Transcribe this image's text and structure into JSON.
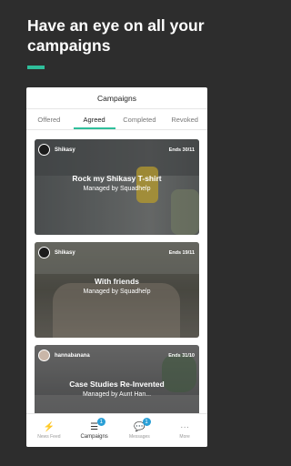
{
  "headline": "Have an eye on all your campaigns",
  "colors": {
    "accent": "#2fbf9b",
    "background": "#2d2d2d",
    "badge": "#2a9fd6"
  },
  "app": {
    "title": "Campaigns"
  },
  "tabs": [
    {
      "label": "Offered"
    },
    {
      "label": "Agreed"
    },
    {
      "label": "Completed"
    },
    {
      "label": "Revoked"
    }
  ],
  "active_tab": "Agreed",
  "campaigns": [
    {
      "brand": "Shikasy",
      "ends": "Ends 30/11",
      "title": "Rock my Shikasy T-shirt",
      "subtitle": "Managed by Squadhelp"
    },
    {
      "brand": "Shikasy",
      "ends": "Ends 19/11",
      "title": "With friends",
      "subtitle": "Managed by Squadhelp"
    },
    {
      "brand": "hannabanana",
      "ends": "Ends 31/10",
      "title": "Case Studies Re-Invented",
      "subtitle": "Managed by Aunt Han..."
    }
  ],
  "nav": [
    {
      "label": "News Feed",
      "icon": "lightning-icon"
    },
    {
      "label": "Campaigns",
      "icon": "list-icon",
      "badge": "1"
    },
    {
      "label": "Messages",
      "icon": "chat-icon",
      "badge": "1"
    },
    {
      "label": "More",
      "icon": "dots-icon"
    }
  ]
}
